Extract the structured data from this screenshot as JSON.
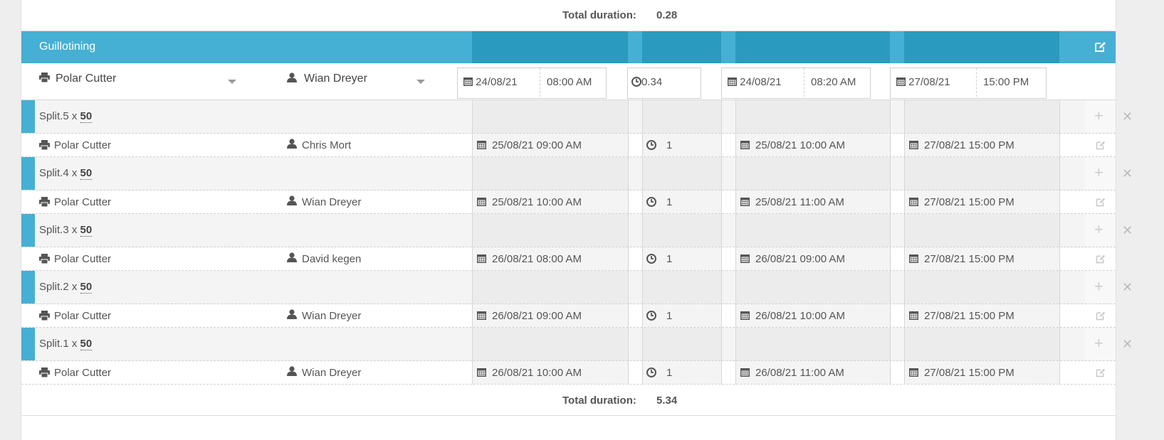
{
  "top_total": {
    "label": "Total duration:",
    "value": "0.28"
  },
  "header": {
    "title": "Guillotining"
  },
  "task": {
    "machine": "Polar Cutter",
    "operator": "Wian Dreyer",
    "start_date": "24/08/21",
    "start_time": "08:00 AM",
    "duration": "0.34",
    "end_date": "24/08/21",
    "end_time": "08:20 AM",
    "due_date": "27/08/21",
    "due_time": "15:00 PM"
  },
  "splits": [
    {
      "name": "Split.5 x ",
      "qty": "50",
      "machine": "Polar Cutter",
      "operator": "Chris Mort",
      "start": "25/08/21 09:00 AM",
      "duration": "1",
      "end": "25/08/21 10:00 AM",
      "due": "27/08/21 15:00 PM"
    },
    {
      "name": "Split.4 x ",
      "qty": "50",
      "machine": "Polar Cutter",
      "operator": "Wian Dreyer",
      "start": "25/08/21 10:00 AM",
      "duration": "1",
      "end": "25/08/21 11:00 AM",
      "due": "27/08/21 15:00 PM"
    },
    {
      "name": "Split.3 x ",
      "qty": "50",
      "machine": "Polar Cutter",
      "operator": "David kegen",
      "start": "26/08/21 08:00 AM",
      "duration": "1",
      "end": "26/08/21 09:00 AM",
      "due": "27/08/21 15:00 PM"
    },
    {
      "name": "Split.2 x ",
      "qty": "50",
      "machine": "Polar Cutter",
      "operator": "Wian Dreyer",
      "start": "26/08/21 09:00 AM",
      "duration": "1",
      "end": "26/08/21 10:00 AM",
      "due": "27/08/21 15:00 PM"
    },
    {
      "name": "Split.1 x ",
      "qty": "50",
      "machine": "Polar Cutter",
      "operator": "Wian Dreyer",
      "start": "26/08/21 10:00 AM",
      "duration": "1",
      "end": "26/08/21 11:00 AM",
      "due": "27/08/21 15:00 PM"
    }
  ],
  "bottom_total": {
    "label": "Total duration:",
    "value": "5.34"
  },
  "icons": {
    "machine": "printer-icon",
    "operator": "user-icon",
    "date": "calendar-icon",
    "duration": "clock-icon",
    "edit": "edit-icon",
    "add": "plus-icon",
    "remove": "close-icon"
  },
  "colors": {
    "accent": "#45b0d3",
    "accent_dark": "#2a9bbf"
  }
}
